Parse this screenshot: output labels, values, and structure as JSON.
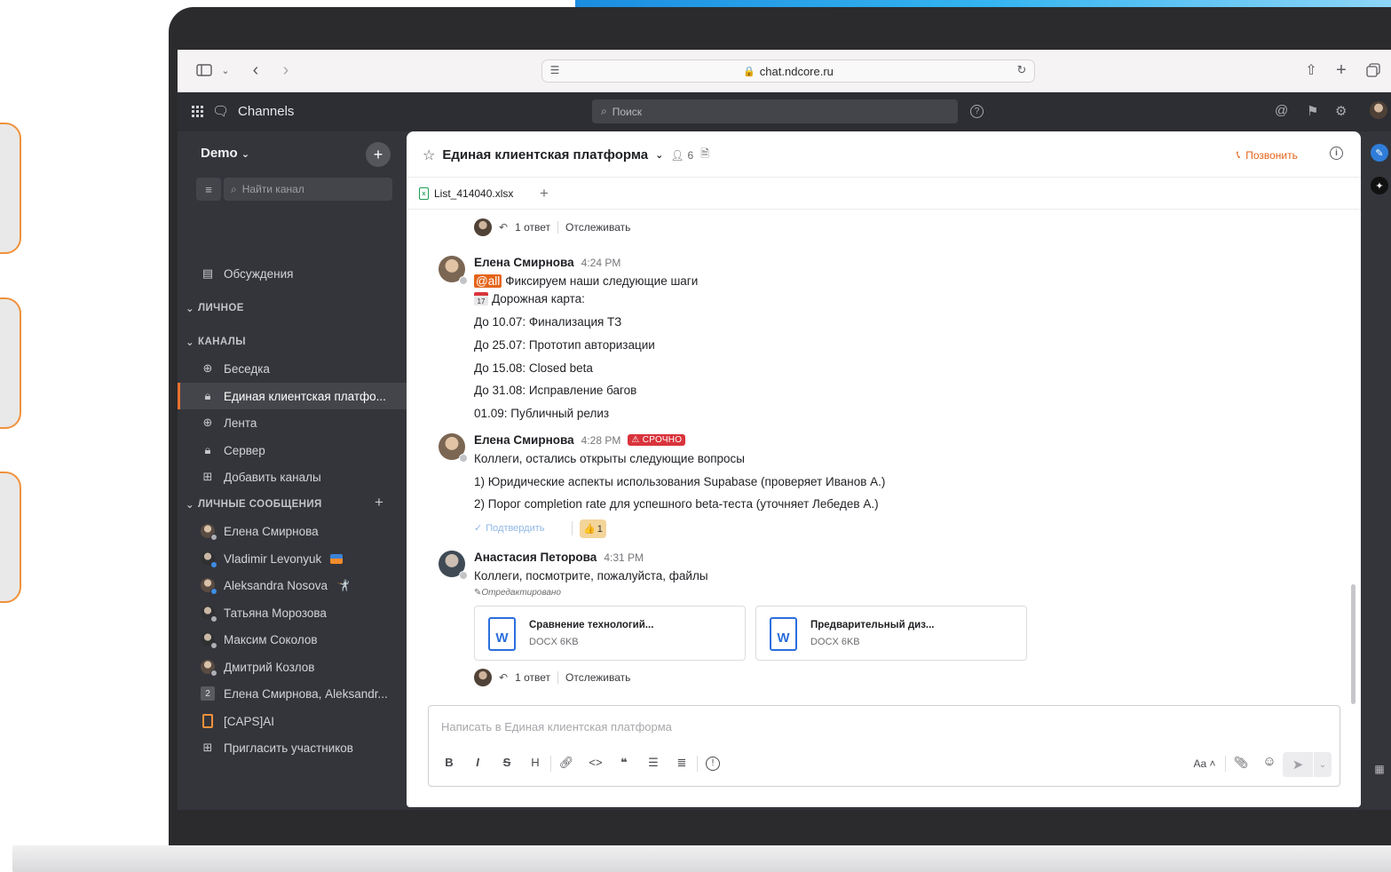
{
  "browser": {
    "url": "chat.ndcore.ru"
  },
  "app": {
    "title": "Channels",
    "search_placeholder": "Поиск"
  },
  "sidebar": {
    "team": "Demo",
    "find_placeholder": "Найти канал",
    "threads_label": "Обсуждения",
    "section_personal": "ЛИЧНОЕ",
    "section_channels": "КАНАЛЫ",
    "channels": [
      {
        "label": "Беседка",
        "icon": "globe-icon"
      },
      {
        "label": "Единая клиентская платфо...",
        "icon": "lock-icon",
        "active": true
      },
      {
        "label": "Лента",
        "icon": "globe-icon"
      },
      {
        "label": "Сервер",
        "icon": "lock-icon"
      },
      {
        "label": "Добавить каналы",
        "icon": "plus-square-icon"
      }
    ],
    "section_dm": "ЛИЧНЫЕ СООБЩЕНИЯ",
    "dms": [
      {
        "label": "Елена Смирнова"
      },
      {
        "label": "Vladimir Levonyuk"
      },
      {
        "label": "Aleksandra Nosova",
        "emoji": "🤺"
      },
      {
        "label": "Татьяна Морозова"
      },
      {
        "label": "Максим Соколов"
      },
      {
        "label": "Дмитрий Козлов"
      },
      {
        "label": "Елена Смирнова, Aleksandr...",
        "count": "2"
      },
      {
        "label": "[CAPS]AI"
      },
      {
        "label": "Пригласить участников"
      }
    ]
  },
  "channel": {
    "title": "Единая клиентская платформа",
    "members": "6",
    "call_label": "Позвонить",
    "tab_file": "List_414040.xlsx"
  },
  "thread": {
    "replies": "1 ответ",
    "follow": "Отслеживать"
  },
  "messages": [
    {
      "author": "Елена Смирнова",
      "time": "4:24 PM",
      "mention": "@all",
      "line1": "Фиксируем наши следующие шаги",
      "calendar_day": "17",
      "line2": "Дорожная карта:",
      "items": [
        "До 10.07: Финализация ТЗ",
        "До 25.07: Прототип авторизации",
        "До 15.08: Closed beta",
        "До 31.08: Исправление багов",
        "01.09: Публичный релиз"
      ]
    },
    {
      "author": "Елена Смирнова",
      "time": "4:28 PM",
      "badge": "СРОЧНО",
      "lines": [
        "Коллеги, остались открыты следующие вопросы",
        "1) Юридические аспекты использования Supabase (проверяет Иванов А.)",
        "2) Порог completion rate для успешного beta-теста (уточняет Лебедев А.)"
      ],
      "confirm": "Подтвердить",
      "reaction": "👍",
      "reaction_count": "1"
    },
    {
      "author": "Анастасия Петорова",
      "time": "4:31 PM",
      "line": "Коллеги, посмотрите, пожалуйста, файлы",
      "edited": "Отредактировано",
      "files": [
        {
          "name": "Сравнение технологий...",
          "meta": "DOCX 6KB"
        },
        {
          "name": "Предварительный диз...",
          "meta": "DOCX 6KB"
        }
      ]
    }
  ],
  "composer": {
    "placeholder": "Написать в Единая клиентская платформа",
    "text_size_label": "Aa"
  },
  "colors": {
    "accent": "#e4641a",
    "urgent": "#d9343c",
    "sidebar": "#34353b"
  }
}
